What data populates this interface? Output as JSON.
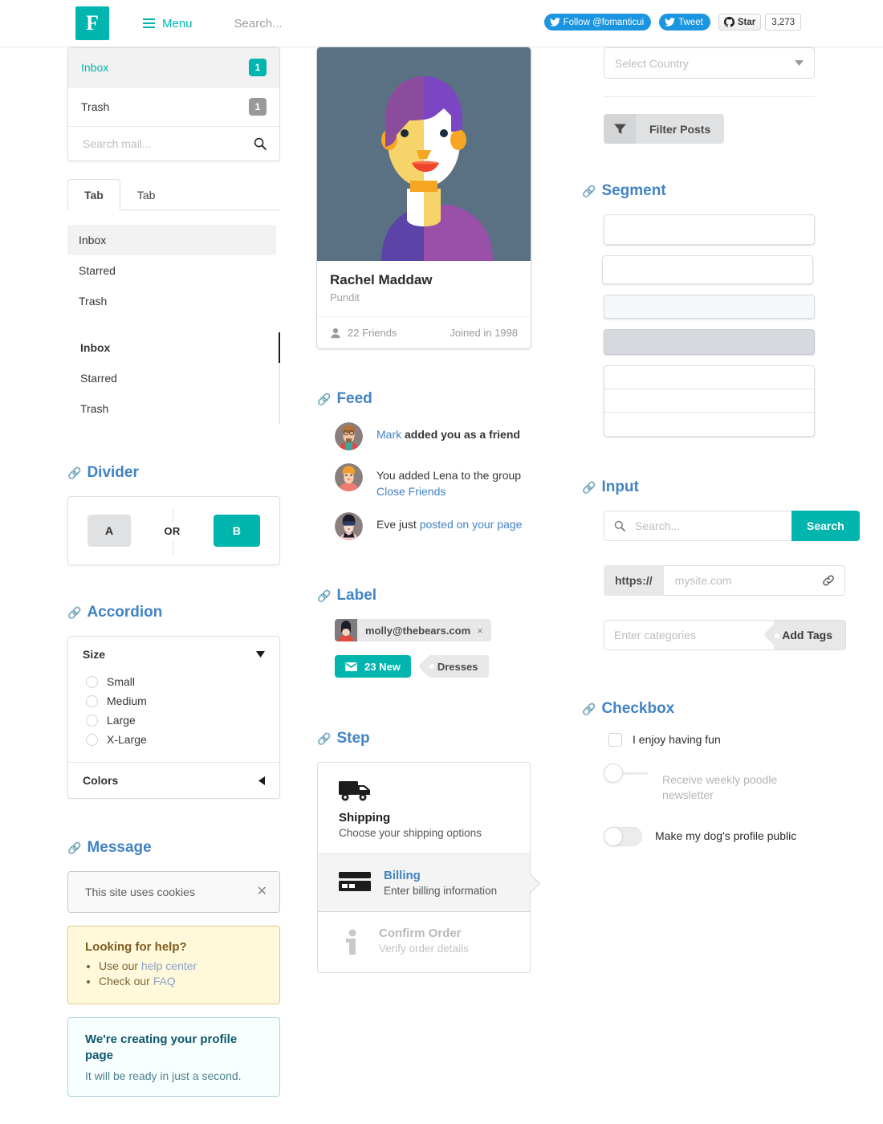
{
  "header": {
    "logo_letter": "F",
    "menu_label": "Menu",
    "search_placeholder": "Search...",
    "follow_label": "Follow @fomanticui",
    "tweet_label": "Tweet",
    "star_label": "Star",
    "star_count": "3,273",
    "accent": "#00b5ad"
  },
  "mail_menu": {
    "items": [
      {
        "label": "Inbox",
        "badge": "1",
        "badge_style": "teal",
        "active": true
      },
      {
        "label": "Trash",
        "badge": "1",
        "badge_style": "grey",
        "active": false
      }
    ],
    "search_placeholder": "Search mail...",
    "search_value": ""
  },
  "tabs": [
    {
      "label": "Tab",
      "active": true
    },
    {
      "label": "Tab",
      "active": false
    }
  ],
  "plain_list": [
    {
      "label": "Inbox",
      "active": true
    },
    {
      "label": "Starred",
      "active": false
    },
    {
      "label": "Trash",
      "active": false
    }
  ],
  "railed_list": [
    {
      "label": "Inbox",
      "active": true
    },
    {
      "label": "Starred",
      "active": false
    },
    {
      "label": "Trash",
      "active": false
    }
  ],
  "divider": {
    "heading": "Divider",
    "button_a": "A",
    "or_text": "OR",
    "button_b": "B"
  },
  "accordion": {
    "heading": "Accordion",
    "panel_size_title": "Size",
    "options": [
      "Small",
      "Medium",
      "Large",
      "X-Large"
    ],
    "panel_colors_title": "Colors"
  },
  "message": {
    "heading": "Message",
    "cookie_text": "This site uses cookies",
    "help_title": "Looking for help?",
    "help_items": [
      {
        "prefix": "Use our ",
        "link": "help center"
      },
      {
        "prefix": "Check our ",
        "link": "FAQ"
      }
    ],
    "info_title": "We're creating your profile page",
    "info_body": "It will be ready in just a second."
  },
  "profile_card": {
    "name": "Rachel Maddaw",
    "role": "Pundit",
    "friends": "22 Friends",
    "joined": "Joined in 1998"
  },
  "feed": {
    "heading": "Feed",
    "items": [
      {
        "link": "Mark",
        "bold_rest": " added you as a friend",
        "plain": "",
        "sub_link": ""
      },
      {
        "link": "",
        "bold_rest": "",
        "plain": "You added Lena to the group",
        "sub_link": "Close Friends"
      },
      {
        "link": "",
        "bold_rest": "",
        "plain": "Eve just ",
        "sub_link": "posted on your page"
      }
    ]
  },
  "label": {
    "heading": "Label",
    "email": "molly@thebears.com",
    "close_glyph": "×",
    "new_count": "23 New",
    "tag_text": "Dresses"
  },
  "step": {
    "heading": "Step",
    "items": [
      {
        "title": "Shipping",
        "desc": "Choose your shipping options",
        "state": "completed",
        "icon": "truck-icon"
      },
      {
        "title": "Billing",
        "desc": "Enter billing information",
        "state": "active",
        "icon": "credit-card-icon"
      },
      {
        "title": "Confirm Order",
        "desc": "Verify order details",
        "state": "disabled",
        "icon": "info-icon"
      }
    ]
  },
  "dropdown": {
    "placeholder": "Select Country"
  },
  "filter": {
    "label": "Filter Posts"
  },
  "segment": {
    "heading": "Segment"
  },
  "input": {
    "heading": "Input",
    "search_placeholder": "Search...",
    "search_value": "",
    "search_button": "Search",
    "url_prefix": "https://",
    "url_placeholder": "mysite.com",
    "url_value": "",
    "tags_placeholder": "Enter categories",
    "tags_value": "",
    "tags_button": "Add Tags"
  },
  "checkbox": {
    "heading": "Checkbox",
    "items": [
      {
        "label": "I enjoy having fun",
        "type": "checkbox",
        "checked": false
      },
      {
        "label": "Receive weekly poodle newsletter",
        "type": "slider",
        "checked": false,
        "disabled": true
      },
      {
        "label": "Make my dog's profile public",
        "type": "toggle",
        "checked": false,
        "disabled": false
      }
    ]
  }
}
